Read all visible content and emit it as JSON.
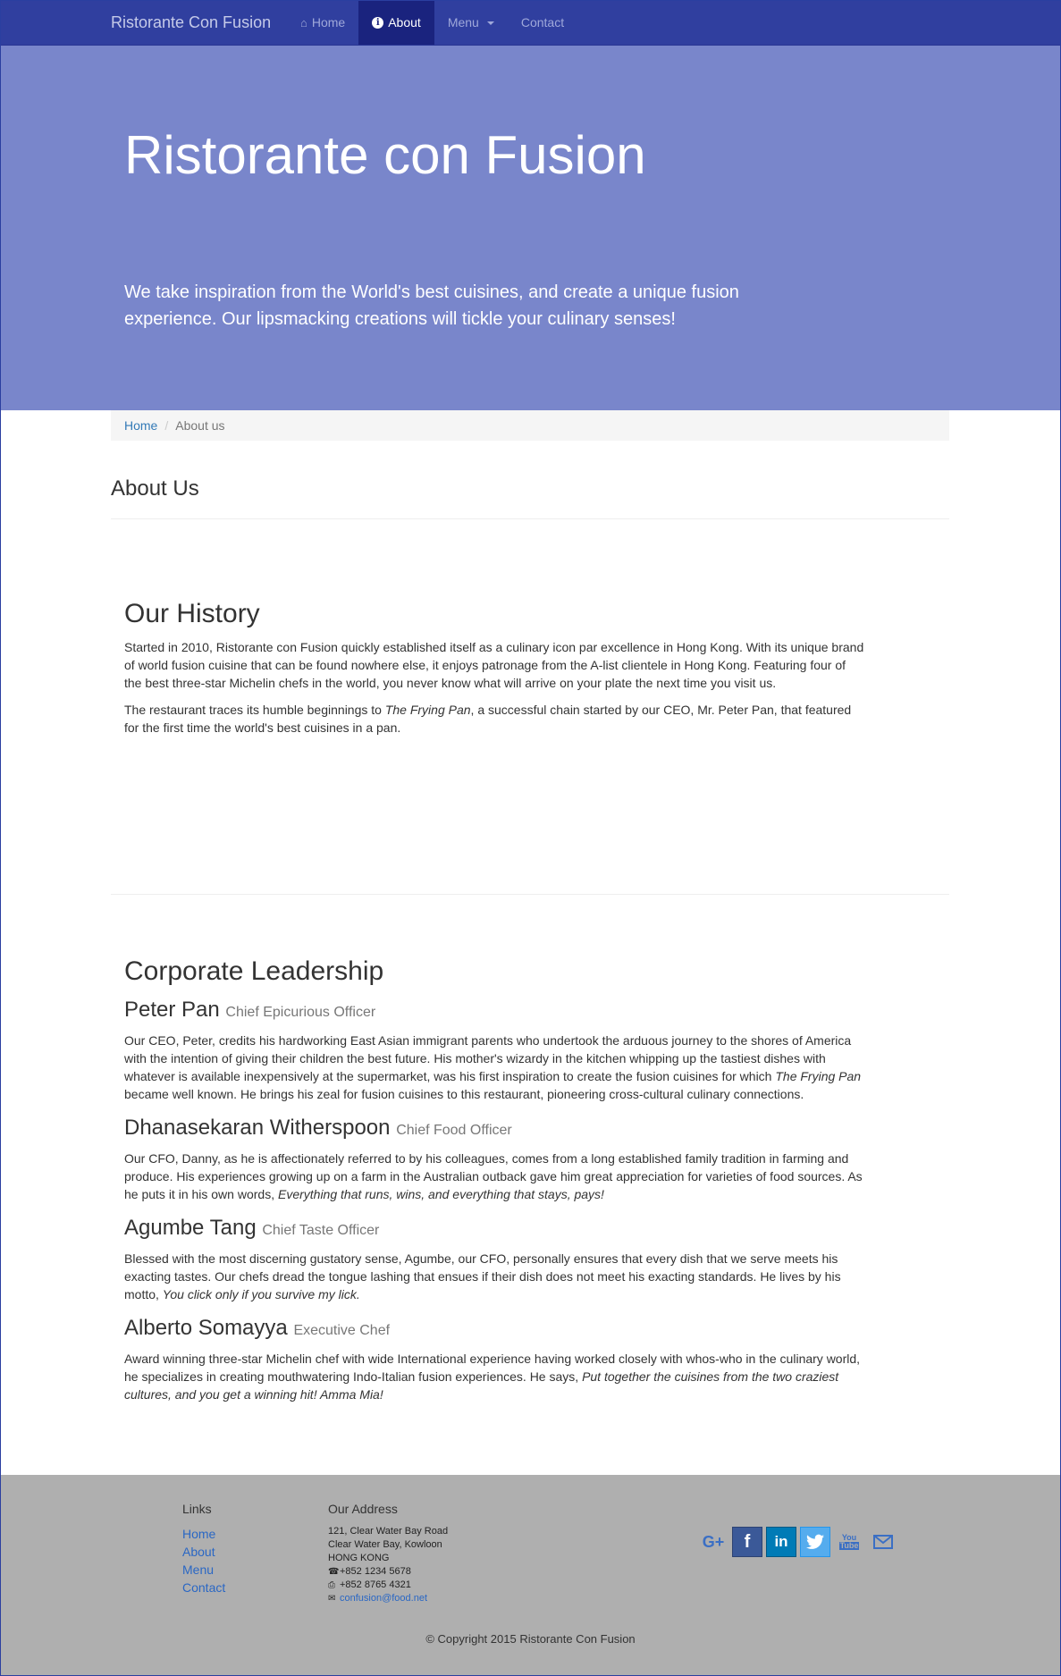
{
  "nav": {
    "brand": "Ristorante Con Fusion",
    "items": [
      {
        "label": "Home"
      },
      {
        "label": "About"
      },
      {
        "label": "Menu"
      },
      {
        "label": "Contact"
      }
    ]
  },
  "jumbotron": {
    "title": "Ristorante con Fusion",
    "text": "We take inspiration from the World's best cuisines, and create a unique fusion experience. Our lipsmacking creations will tickle your culinary senses!"
  },
  "breadcrumb": {
    "home": "Home",
    "current": "About us"
  },
  "page_title": "About Us",
  "history": {
    "heading": "Our History",
    "p1": "Started in 2010, Ristorante con Fusion quickly established itself as a culinary icon par excellence in Hong Kong. With its unique brand of world fusion cuisine that can be found nowhere else, it enjoys patronage from the A-list clientele in Hong Kong. Featuring four of the best three-star Michelin chefs in the world, you never know what will arrive on your plate the next time you visit us.",
    "p2_before": "The restaurant traces its humble beginnings to ",
    "p2_em": "The Frying Pan",
    "p2_after": ", a successful chain started by our CEO, Mr. Peter Pan, that featured for the first time the world's best cuisines in a pan."
  },
  "leadership": {
    "heading": "Corporate Leadership",
    "leaders": [
      {
        "name": "Peter Pan",
        "title": "Chief Epicurious Officer",
        "text": "Our CEO, Peter, credits his hardworking East Asian immigrant parents who undertook the arduous journey to the shores of America with the intention of giving their children the best future. His mother's wizardy in the kitchen whipping up the tastiest dishes with whatever is available inexpensively at the supermarket, was his first inspiration to create the fusion cuisines for which ",
        "em": "The Frying Pan",
        "after": " became well known. He brings his zeal for fusion cuisines to this restaurant, pioneering cross-cultural culinary connections."
      },
      {
        "name": "Dhanasekaran Witherspoon",
        "title": "Chief Food Officer",
        "text": "Our CFO, Danny, as he is affectionately referred to by his colleagues, comes from a long established family tradition in farming and produce. His experiences growing up on a farm in the Australian outback gave him great appreciation for varieties of food sources. As he puts it in his own words, ",
        "em": "Everything that runs, wins, and everything that stays, pays!",
        "after": ""
      },
      {
        "name": "Agumbe Tang",
        "title": "Chief Taste Officer",
        "text": "Blessed with the most discerning gustatory sense, Agumbe, our CFO, personally ensures that every dish that we serve meets his exacting tastes. Our chefs dread the tongue lashing that ensues if their dish does not meet his exacting standards. He lives by his motto, ",
        "em": "You click only if you survive my lick.",
        "after": ""
      },
      {
        "name": "Alberto Somayya",
        "title": "Executive Chef",
        "text": "Award winning three-star Michelin chef with wide International experience having worked closely with whos-who in the culinary world, he specializes in creating mouthwatering Indo-Italian fusion experiences. He says, ",
        "em": "Put together the cuisines from the two craziest cultures, and you get a winning hit! Amma Mia!",
        "after": ""
      }
    ]
  },
  "footer": {
    "links_heading": "Links",
    "links": [
      "Home",
      "About",
      "Menu",
      "Contact"
    ],
    "address_heading": "Our Address",
    "address": [
      "121, Clear Water Bay Road",
      "Clear Water Bay, Kowloon",
      "HONG KONG"
    ],
    "phone": "+852 1234 5678",
    "fax": "+852 8765 4321",
    "email": "confusion@food.net",
    "social": [
      "google-plus-icon",
      "facebook-icon",
      "linkedin-icon",
      "twitter-icon",
      "youtube-icon",
      "envelope-icon"
    ],
    "copyright": "© Copyright 2015 Ristorante Con Fusion"
  }
}
